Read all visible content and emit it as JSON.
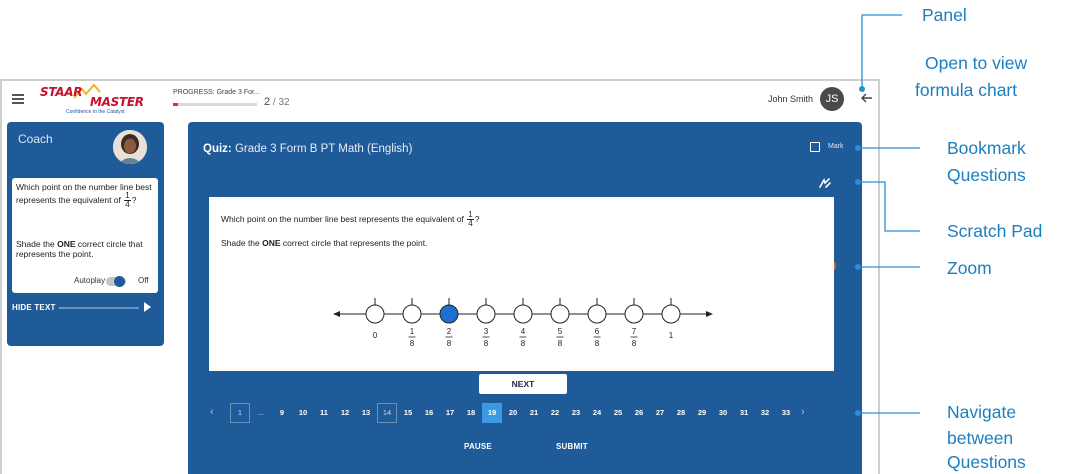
{
  "header": {
    "menu_icon": "hamburger-menu-icon",
    "logo": {
      "part1": "STAAR",
      "part2": "MASTER",
      "tagline": "Confidence to the Catalyst"
    },
    "progress": {
      "label": "PROGRESS:",
      "test_name": "Grade 3 For...",
      "current": "2",
      "total": "/ 32",
      "fraction": 0.0625
    },
    "user": {
      "name": "John Smith",
      "initials": "JS"
    },
    "back_icon": "arrow-left-icon"
  },
  "coach": {
    "title": "Coach",
    "question_text": "Which point on the number line best represents the equivalent of",
    "fraction_num": "1",
    "fraction_den": "4",
    "fraction_suffix": "?",
    "shade_pre": "Shade the ",
    "shade_bold": "ONE",
    "shade_post": " correct circle that represents the point.",
    "autoplay_label": "Autoplay",
    "autoplay_state": "Off",
    "hide_text_label": "HIDE TEXT"
  },
  "quiz": {
    "title_prefix": "Quiz:",
    "title": " Grade 3 Form B PT Math (English)",
    "mark_label": "Mark",
    "question_line1": "Which point on the number line best represents the equivalent of",
    "frac_num": "1",
    "frac_den": "4",
    "q_suffix": "?",
    "shade_pre": "Shade the ",
    "shade_bold": "ONE",
    "shade_post": " correct circle that represents the point.",
    "number_line": {
      "labels": [
        {
          "whole": "0"
        },
        {
          "num": "1",
          "den": "8"
        },
        {
          "num": "2",
          "den": "8"
        },
        {
          "num": "3",
          "den": "8"
        },
        {
          "num": "4",
          "den": "8"
        },
        {
          "num": "5",
          "den": "8"
        },
        {
          "num": "6",
          "den": "8"
        },
        {
          "num": "7",
          "den": "8"
        },
        {
          "whole": "1"
        }
      ],
      "selected_index": 2,
      "selected_color": "#1f6fd0"
    },
    "next_label": "NEXT",
    "pager": {
      "items": [
        "1",
        "...",
        "9",
        "10",
        "11",
        "12",
        "13",
        "14",
        "15",
        "16",
        "17",
        "18",
        "19",
        "20",
        "21",
        "22",
        "23",
        "24",
        "25",
        "26",
        "27",
        "28",
        "29",
        "30",
        "31",
        "32",
        "33"
      ],
      "boxed": [
        "1",
        "14"
      ],
      "active": "19",
      "prev_icon": "chevron-left-icon",
      "next_icon": "chevron-right-icon"
    },
    "pause_label": "PAUSE",
    "submit_label": "SUBMIT"
  },
  "annotations": {
    "panel": "Panel",
    "panel_desc1": "Open to view",
    "panel_desc2": "formula chart",
    "bookmark1": "Bookmark",
    "bookmark2": "Questions",
    "scratch": "Scratch Pad",
    "zoom": "Zoom",
    "navigate1": "Navigate",
    "navigate2": "between",
    "navigate3": "Questions"
  },
  "colors": {
    "panel_blue": "#1e5b98",
    "annotation_blue": "#1b7fc2",
    "progress_red": "#e0312f",
    "zoom_orange": "#e4622b",
    "active_page": "#3a9ae4"
  }
}
